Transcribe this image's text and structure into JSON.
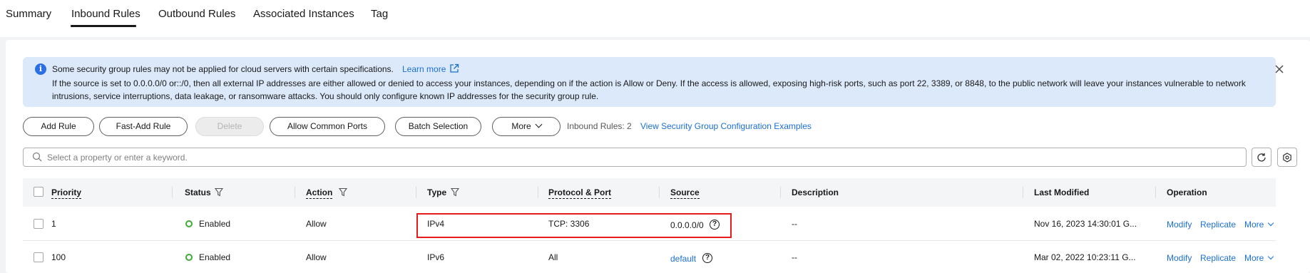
{
  "tabs": [
    {
      "label": "Summary"
    },
    {
      "label": "Inbound Rules"
    },
    {
      "label": "Outbound Rules"
    },
    {
      "label": "Associated Instances"
    },
    {
      "label": "Tag"
    }
  ],
  "active_tab": "Inbound Rules",
  "alert": {
    "line1": "Some security group rules may not be applied for cloud servers with certain specifications.",
    "link": "Learn more",
    "line2": "If the source is set to 0.0.0.0/0 or::/0, then all external IP addresses are either allowed or denied to access your instances, depending on if the action is Allow or Deny. If the access is allowed, exposing high-risk ports, such as port 22, 3389, or 8848, to the public network will leave your instances vulnerable to network intrusions, service interruptions, data leakage, or ransomware attacks. You should only configure known IP addresses for the security group rule."
  },
  "toolbar": {
    "add_rule": "Add Rule",
    "fast_add_rule": "Fast-Add Rule",
    "delete": "Delete",
    "allow_common_ports": "Allow Common Ports",
    "batch_selection": "Batch Selection",
    "more": "More",
    "rules_count": "Inbound Rules: 2",
    "examples_link": "View Security Group Configuration Examples"
  },
  "search": {
    "placeholder": "Select a property or enter a keyword."
  },
  "table": {
    "headers": {
      "priority": "Priority",
      "status": "Status",
      "action": "Action",
      "type": "Type",
      "protocol_port": "Protocol & Port",
      "source": "Source",
      "description": "Description",
      "last_modified": "Last Modified",
      "operation": "Operation"
    },
    "rows": [
      {
        "priority": "1",
        "status": "Enabled",
        "action": "Allow",
        "type": "IPv4",
        "protocol_port": "TCP: 3306",
        "source": "0.0.0.0/0",
        "description": "--",
        "last_modified": "Nov 16, 2023 14:30:01 G...",
        "op_modify": "Modify",
        "op_replicate": "Replicate",
        "op_more": "More"
      },
      {
        "priority": "100",
        "status": "Enabled",
        "action": "Allow",
        "type": "IPv6",
        "protocol_port": "All",
        "source": "default",
        "description": "--",
        "last_modified": "Mar 02, 2022 10:23:11 G...",
        "op_modify": "Modify",
        "op_replicate": "Replicate",
        "op_more": "More"
      }
    ]
  },
  "colors": {
    "accent": "#1a6fd6",
    "alert_bg": "#dce9fb",
    "status_enabled": "#3fa93a",
    "highlight": "#e81b1b"
  }
}
